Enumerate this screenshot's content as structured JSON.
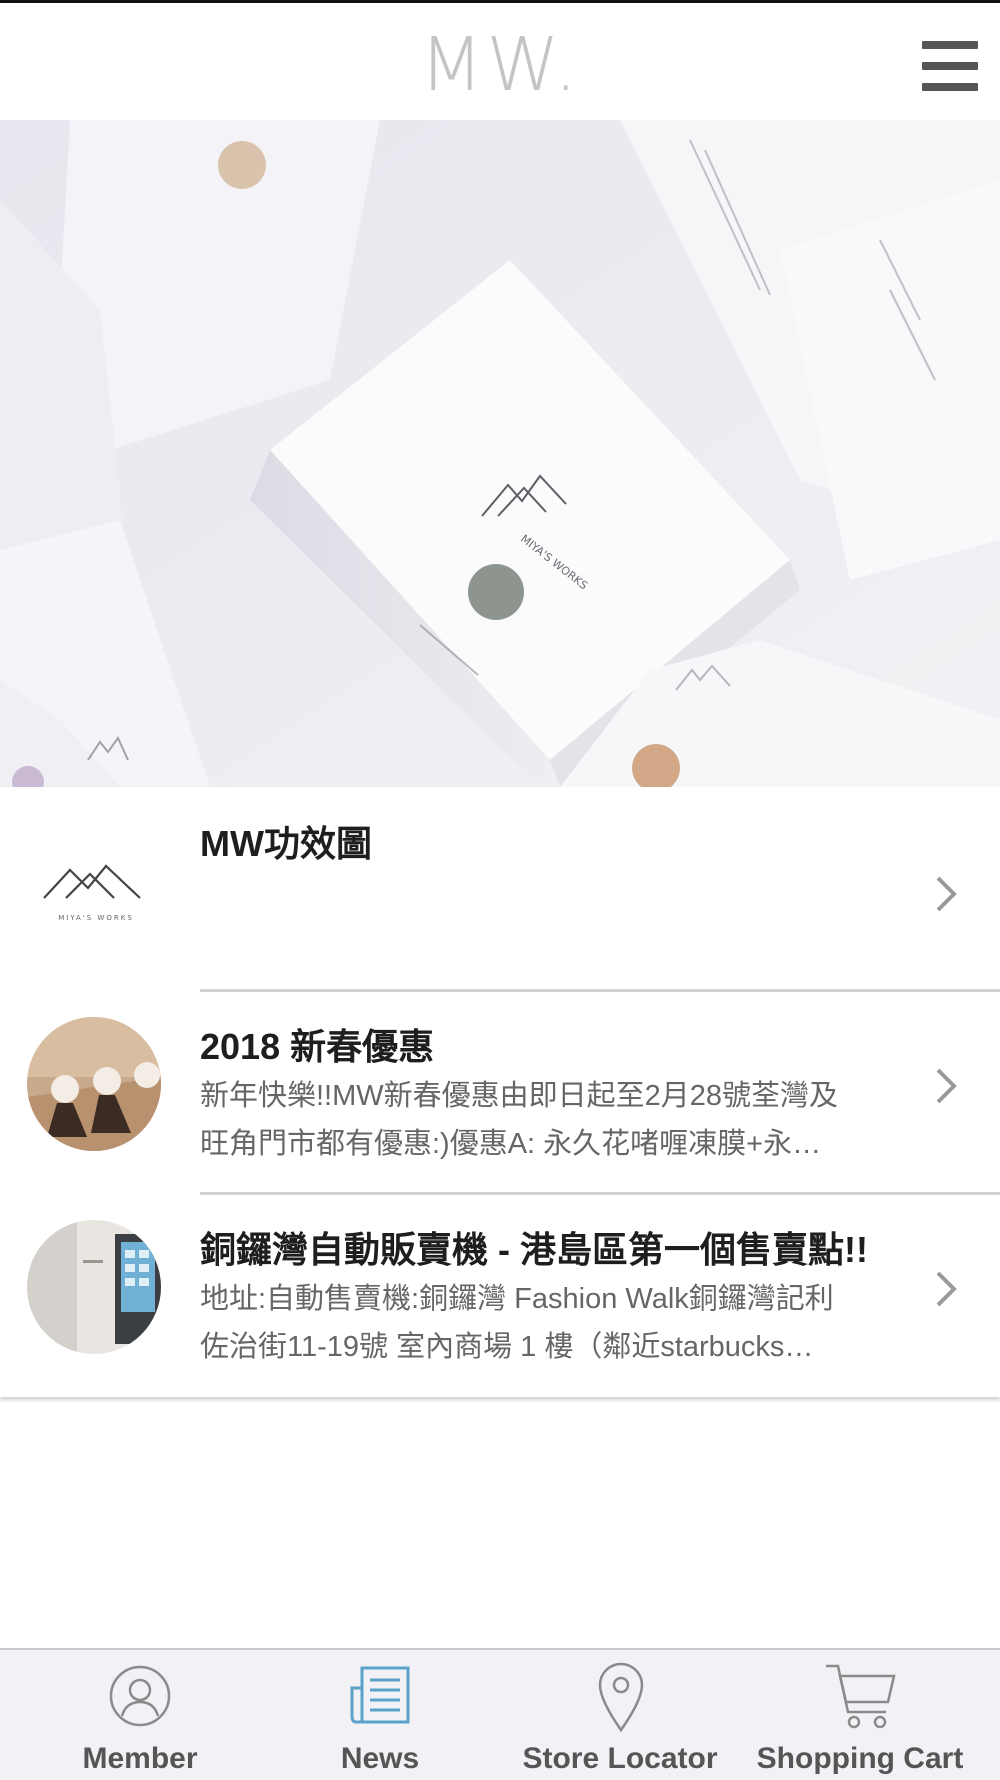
{
  "header": {
    "logo": "MW.",
    "menu_icon": "hamburger-menu-icon"
  },
  "hero": {
    "alt": "hero-banner-image",
    "box_brand": "MIYA'S WORKS"
  },
  "news": [
    {
      "title": "MW功效圖",
      "description_lines": [],
      "thumbnail": "miyas-works-logo",
      "thumbnail_text": "MIYA'S WORKS"
    },
    {
      "title": "2018 新春優惠",
      "description_lines": [
        "新年快樂!!MW新春優惠由即日起至2月28號荃灣及",
        "旺角門市都有優惠:)優惠A: 永久花啫喱凍膜+永…"
      ],
      "thumbnail": "product-photo"
    },
    {
      "title": "銅鑼灣自動販賣機 - 港島區第一個售賣點!!",
      "description_lines": [
        "地址:自動售賣機:銅鑼灣 Fashion Walk銅鑼灣記利",
        "佐治街11-19號 室內商場 1 樓（鄰近starbucks…"
      ],
      "thumbnail": "vending-machine-photo"
    }
  ],
  "tabbar": {
    "active_color": "#5aa2c8",
    "inactive_color": "#8a8a8a",
    "tabs": [
      {
        "label": "Member",
        "icon": "user-icon",
        "active": false
      },
      {
        "label": "News",
        "icon": "newspaper-icon",
        "active": true
      },
      {
        "label": "Store Locator",
        "icon": "location-pin-icon",
        "active": false
      },
      {
        "label": "Shopping Cart",
        "icon": "shopping-cart-icon",
        "active": false
      }
    ]
  }
}
